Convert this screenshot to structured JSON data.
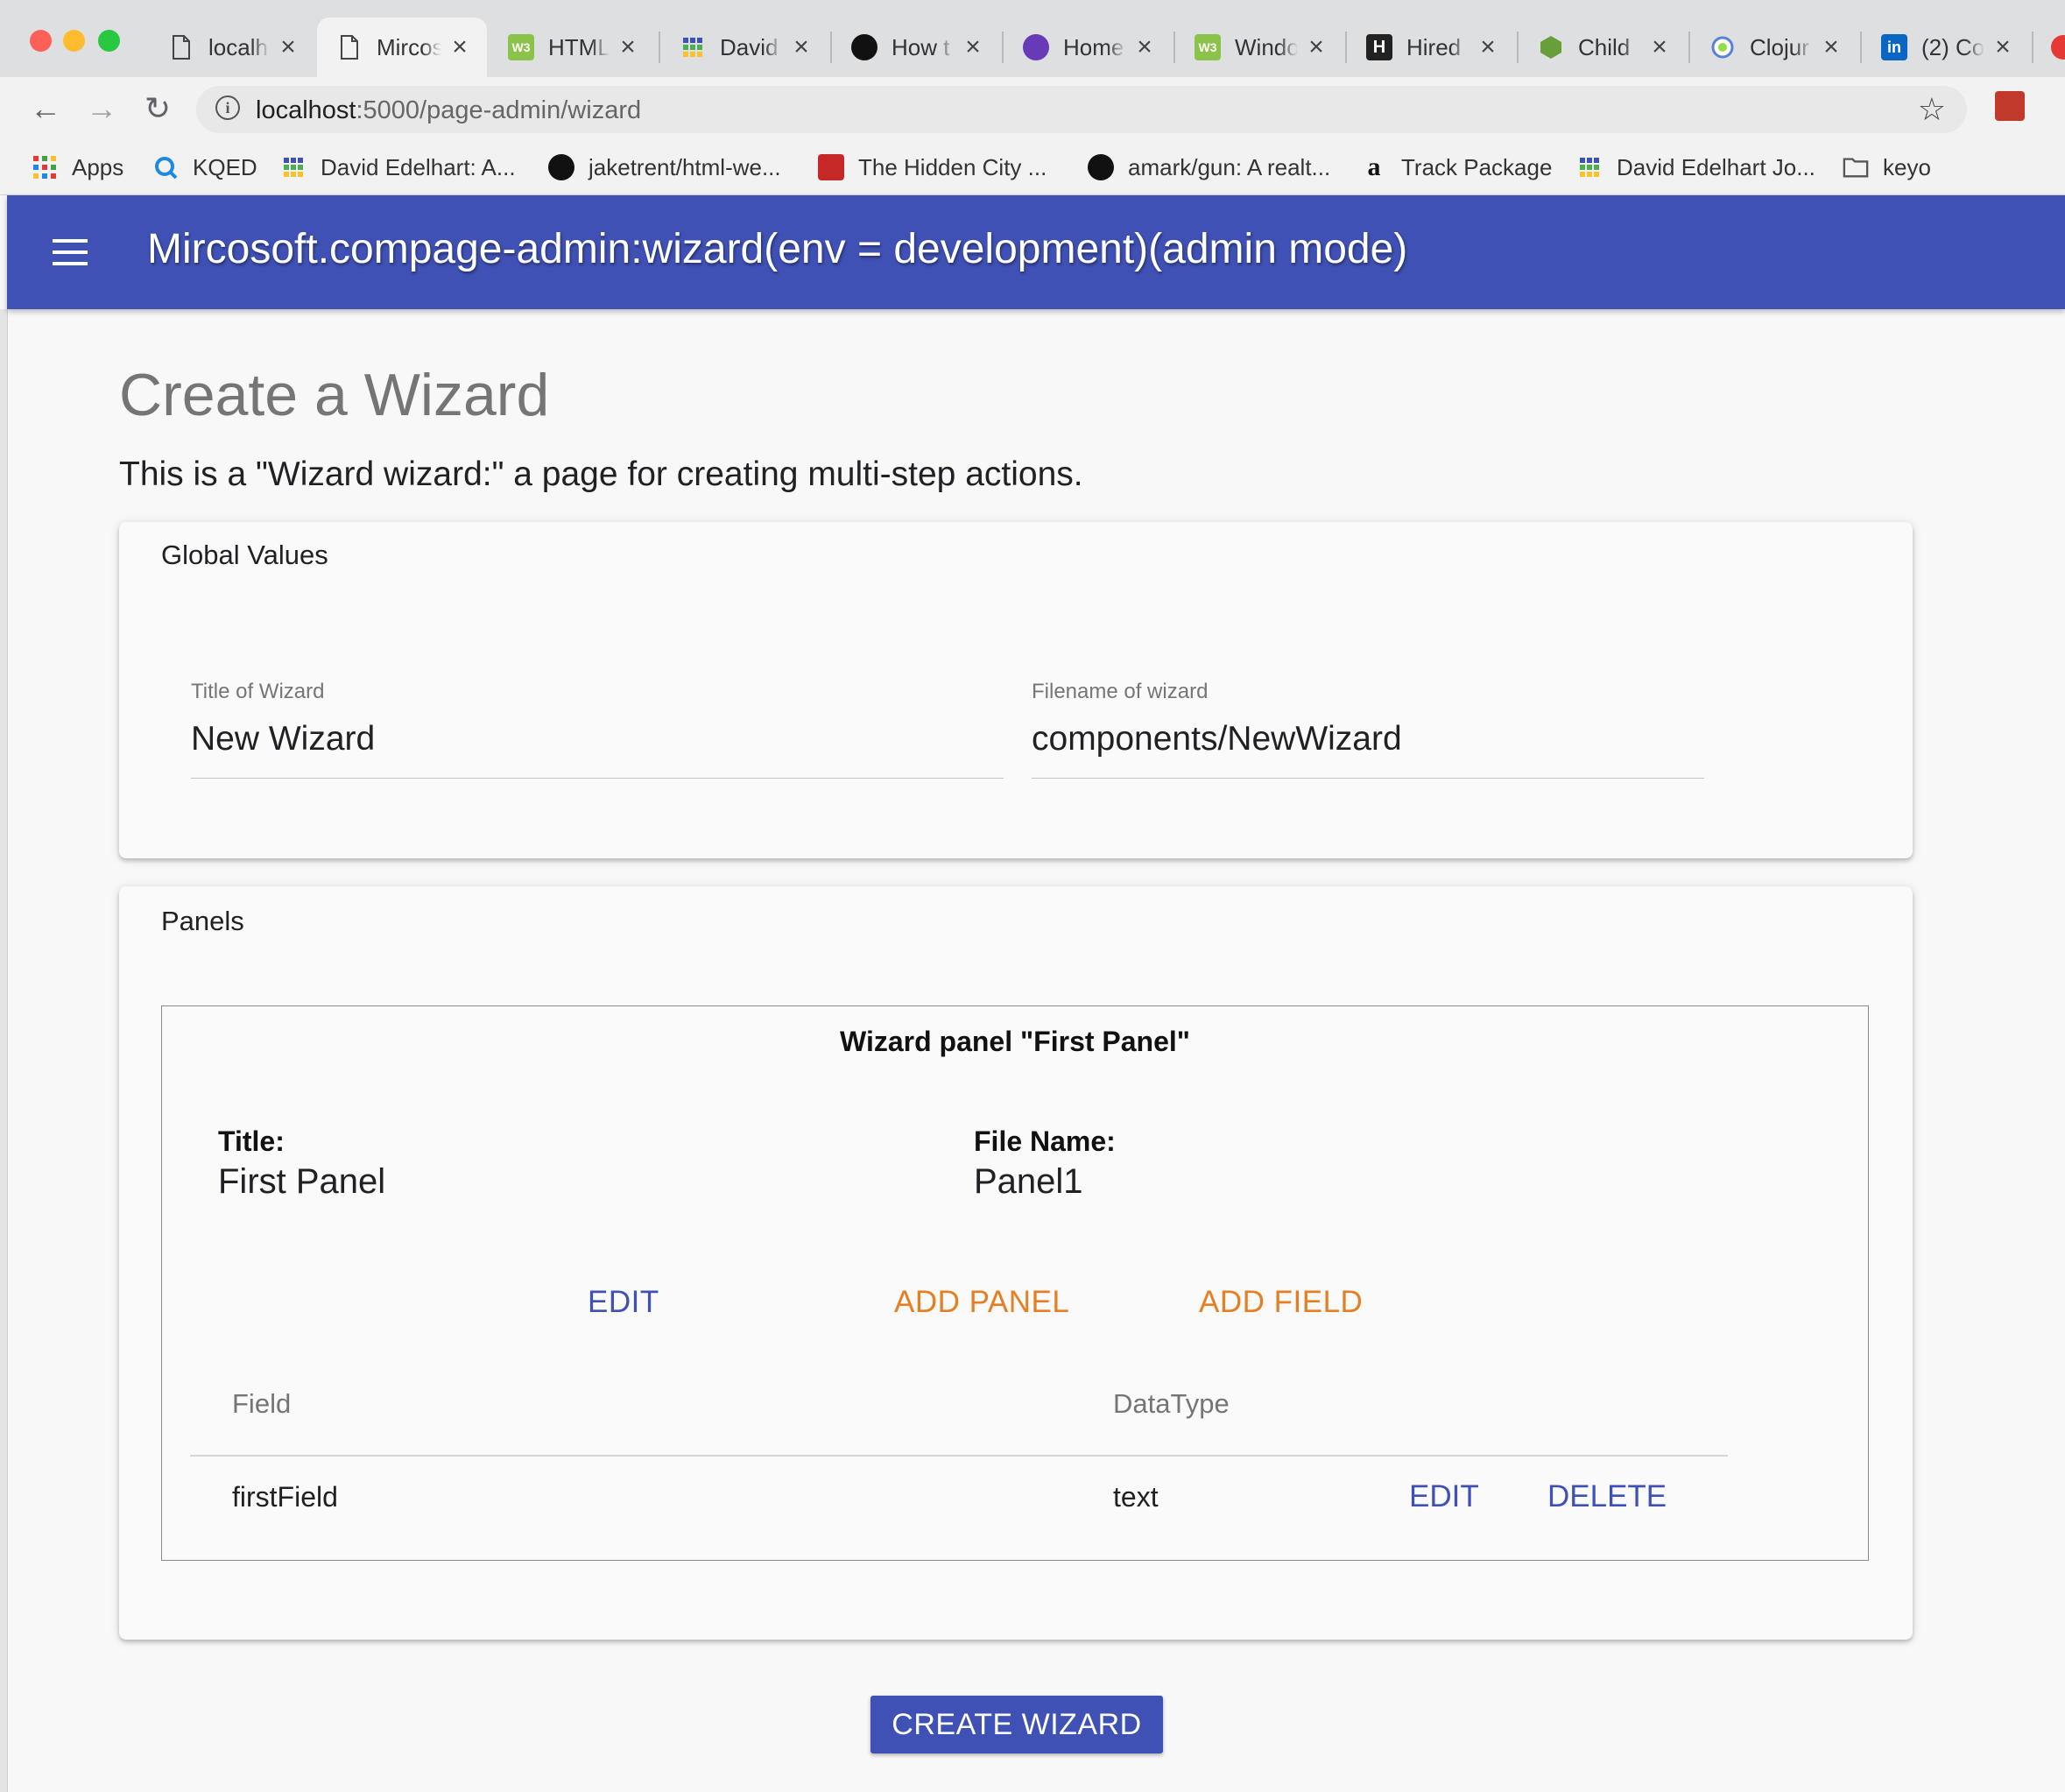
{
  "browser": {
    "tabs": [
      {
        "title": "localh",
        "icon": "document-icon"
      },
      {
        "title": "Mircos",
        "icon": "document-icon",
        "active": true
      },
      {
        "title": "HTML",
        "icon": "w3c-icon"
      },
      {
        "title": "David",
        "icon": "google-sheets-icon"
      },
      {
        "title": "How t",
        "icon": "github-icon"
      },
      {
        "title": "Home",
        "icon": "home-app-icon"
      },
      {
        "title": "Windo",
        "icon": "w3c-icon"
      },
      {
        "title": "Hired",
        "icon": "hired-icon"
      },
      {
        "title": "Child",
        "icon": "nodejs-icon"
      },
      {
        "title": "Clojur",
        "icon": "clojure-icon"
      },
      {
        "title": "(2) Co",
        "icon": "linkedin-icon"
      }
    ],
    "tab_close": "×",
    "url_host": "localhost",
    "url_path": ":5000/page-admin/wizard",
    "bookmarks": [
      {
        "label": "Apps",
        "icon": "apps-grid-icon"
      },
      {
        "label": "KQED",
        "icon": "kqed-icon"
      },
      {
        "label": "David Edelhart: A...",
        "icon": "google-sheets-icon"
      },
      {
        "label": "jaketrent/html-we...",
        "icon": "github-icon"
      },
      {
        "label": "The Hidden City ...",
        "icon": "hidden-city-icon"
      },
      {
        "label": "amark/gun: A realt...",
        "icon": "github-icon"
      },
      {
        "label": "Track Package",
        "icon": "amazon-icon"
      },
      {
        "label": "David Edelhart Jo...",
        "icon": "google-sheets-icon"
      },
      {
        "label": "keyo",
        "icon": "folder-icon"
      }
    ]
  },
  "app": {
    "title": "Mircosoft.compage-admin:wizard(env = development)(admin mode)",
    "brand_color": "#3f51b5",
    "accent_color": "#e67e22"
  },
  "page": {
    "title": "Create a Wizard",
    "description": "This is a \"Wizard wizard:\" a page for creating multi-step actions."
  },
  "global_values": {
    "title": "Global Values",
    "wizard_title_label": "Title of Wizard",
    "wizard_title_value": "New Wizard",
    "filename_label": "Filename of wizard",
    "filename_value": "components/NewWizard"
  },
  "panels": {
    "title": "Panels",
    "panel": {
      "heading": "Wizard panel \"First Panel\"",
      "title_label": "Title:",
      "title_value": "First Panel",
      "filename_label": "File Name:",
      "filename_value": "Panel1",
      "edit_label": "EDIT",
      "add_panel_label": "ADD PANEL",
      "add_field_label": "ADD FIELD",
      "table": {
        "headers": [
          "Field",
          "DataType"
        ],
        "rows": [
          {
            "field": "firstField",
            "datatype": "text",
            "edit": "EDIT",
            "delete": "DELETE"
          }
        ]
      }
    }
  },
  "create_button_label": "CREATE WIZARD"
}
